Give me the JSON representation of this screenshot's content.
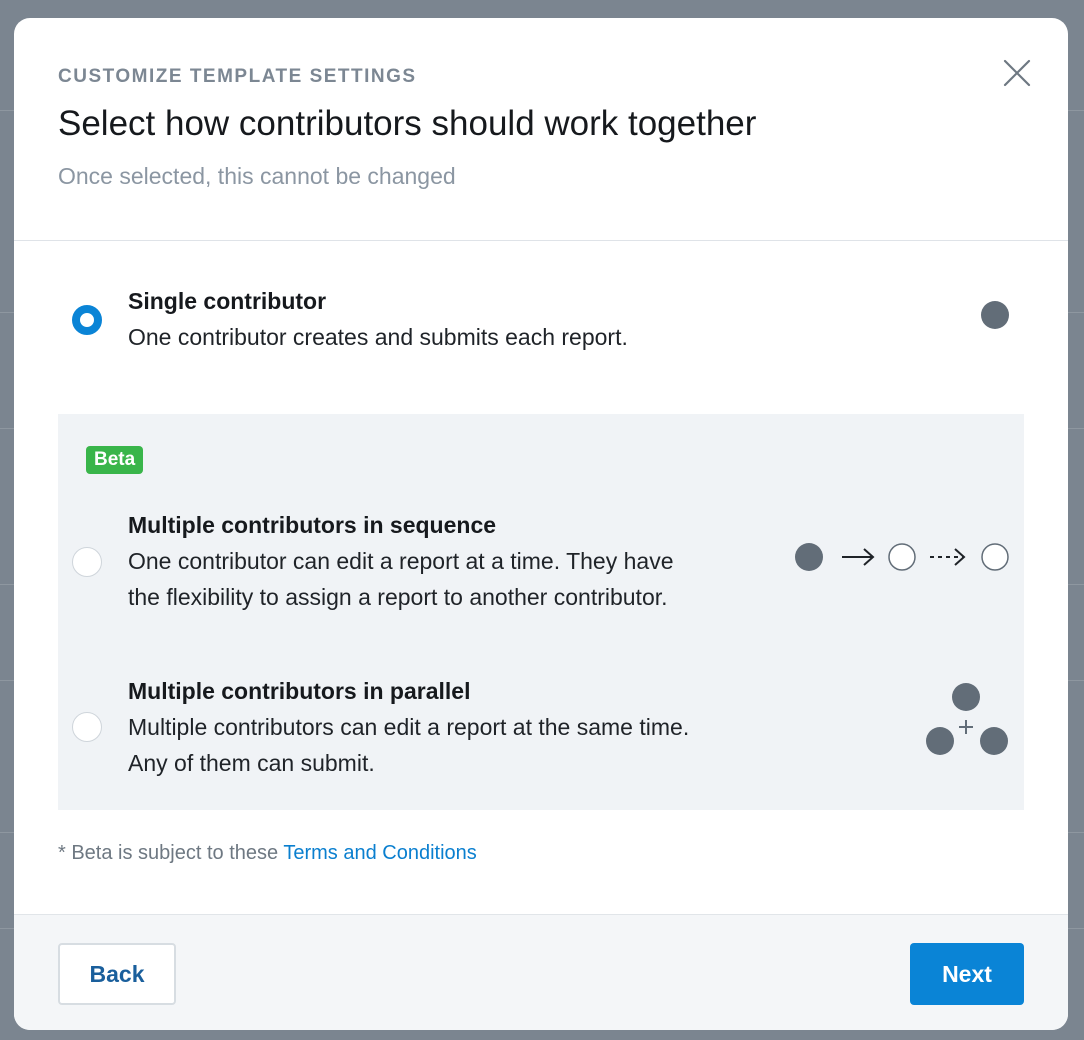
{
  "modal": {
    "eyebrow": "CUSTOMIZE TEMPLATE SETTINGS",
    "title": "Select how contributors should work together",
    "subtitle": "Once selected, this cannot be changed"
  },
  "options": [
    {
      "title": "Single contributor",
      "desc": "One contributor creates and submits each report.",
      "selected": true,
      "illustration": "single-dot-icon"
    },
    {
      "title": "Multiple contributors in sequence",
      "desc_line1": "One contributor can edit a report at a time. They have",
      "desc_line2": "the flexibility to assign a report to another contributor.",
      "selected": false,
      "illustration": "sequence-icon"
    },
    {
      "title": "Multiple contributors in parallel",
      "desc_line1": "Multiple contributors can edit a report at the same time.",
      "desc_line2": "Any of them can submit.",
      "selected": false,
      "illustration": "parallel-icon"
    }
  ],
  "beta": {
    "badge": "Beta"
  },
  "footnote": {
    "prefix": "* Beta is subject to these",
    "link": "Terms and Conditions"
  },
  "footer": {
    "back_label": "Back",
    "next_label": "Next"
  },
  "colors": {
    "accent": "#0a84d6",
    "beta": "#39b54a",
    "dot": "#626d78"
  }
}
